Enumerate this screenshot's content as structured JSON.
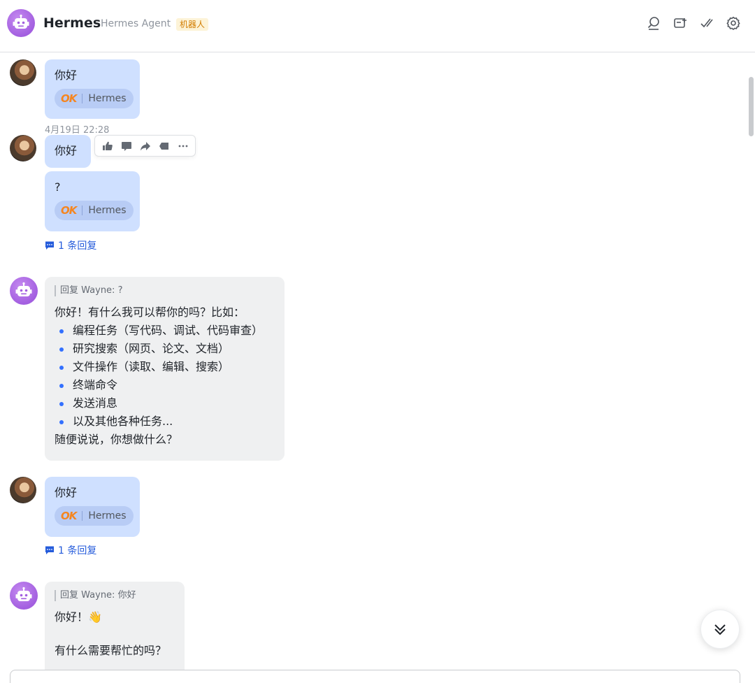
{
  "header": {
    "title": "Hermes",
    "subtitle": "Hermes Agent",
    "badge": "机器人",
    "badge_color": "#d27c00",
    "actions": [
      "search-icon",
      "add-screen-icon",
      "double-check-icon",
      "gear-icon"
    ]
  },
  "colors": {
    "my_bubble": "#cfe0ff",
    "bot_bubble": "#eff0f1",
    "link": "#245bdb",
    "bullet": "#3370ff",
    "ok_orange": "#f5851f"
  },
  "messages": {
    "m1": {
      "text": "你好",
      "reaction_label": "OK",
      "reaction_name": "Hermes"
    },
    "timestamp": "4月19日 22:28",
    "m2": {
      "text": "你好"
    },
    "hover_toolbar": [
      "thumbs-up-icon",
      "comment-icon",
      "forward-icon",
      "pin-icon",
      "more-icon"
    ],
    "m3": {
      "text": "?",
      "reaction_label": "OK",
      "reaction_name": "Hermes",
      "thread_link": "1 条回复"
    },
    "b1": {
      "quote": "回复 Wayne: ?",
      "intro": "你好！有什么我可以帮你的吗？比如：",
      "items": [
        "编程任务（写代码、调试、代码审查）",
        "研究搜索（网页、论文、文档）",
        "文件操作（读取、编辑、搜索）",
        "终端命令",
        "发送消息",
        "以及其他各种任务..."
      ],
      "outro": "随便说说，你想做什么？"
    },
    "m4": {
      "text": "你好",
      "reaction_label": "OK",
      "reaction_name": "Hermes",
      "thread_link": "1 条回复"
    },
    "b2": {
      "quote": "回复 Wayne: 你好",
      "line1": "你好！👋",
      "line2": "有什么需要帮忙的吗？"
    }
  },
  "scroll_to_bottom": "chevrons-down-icon"
}
